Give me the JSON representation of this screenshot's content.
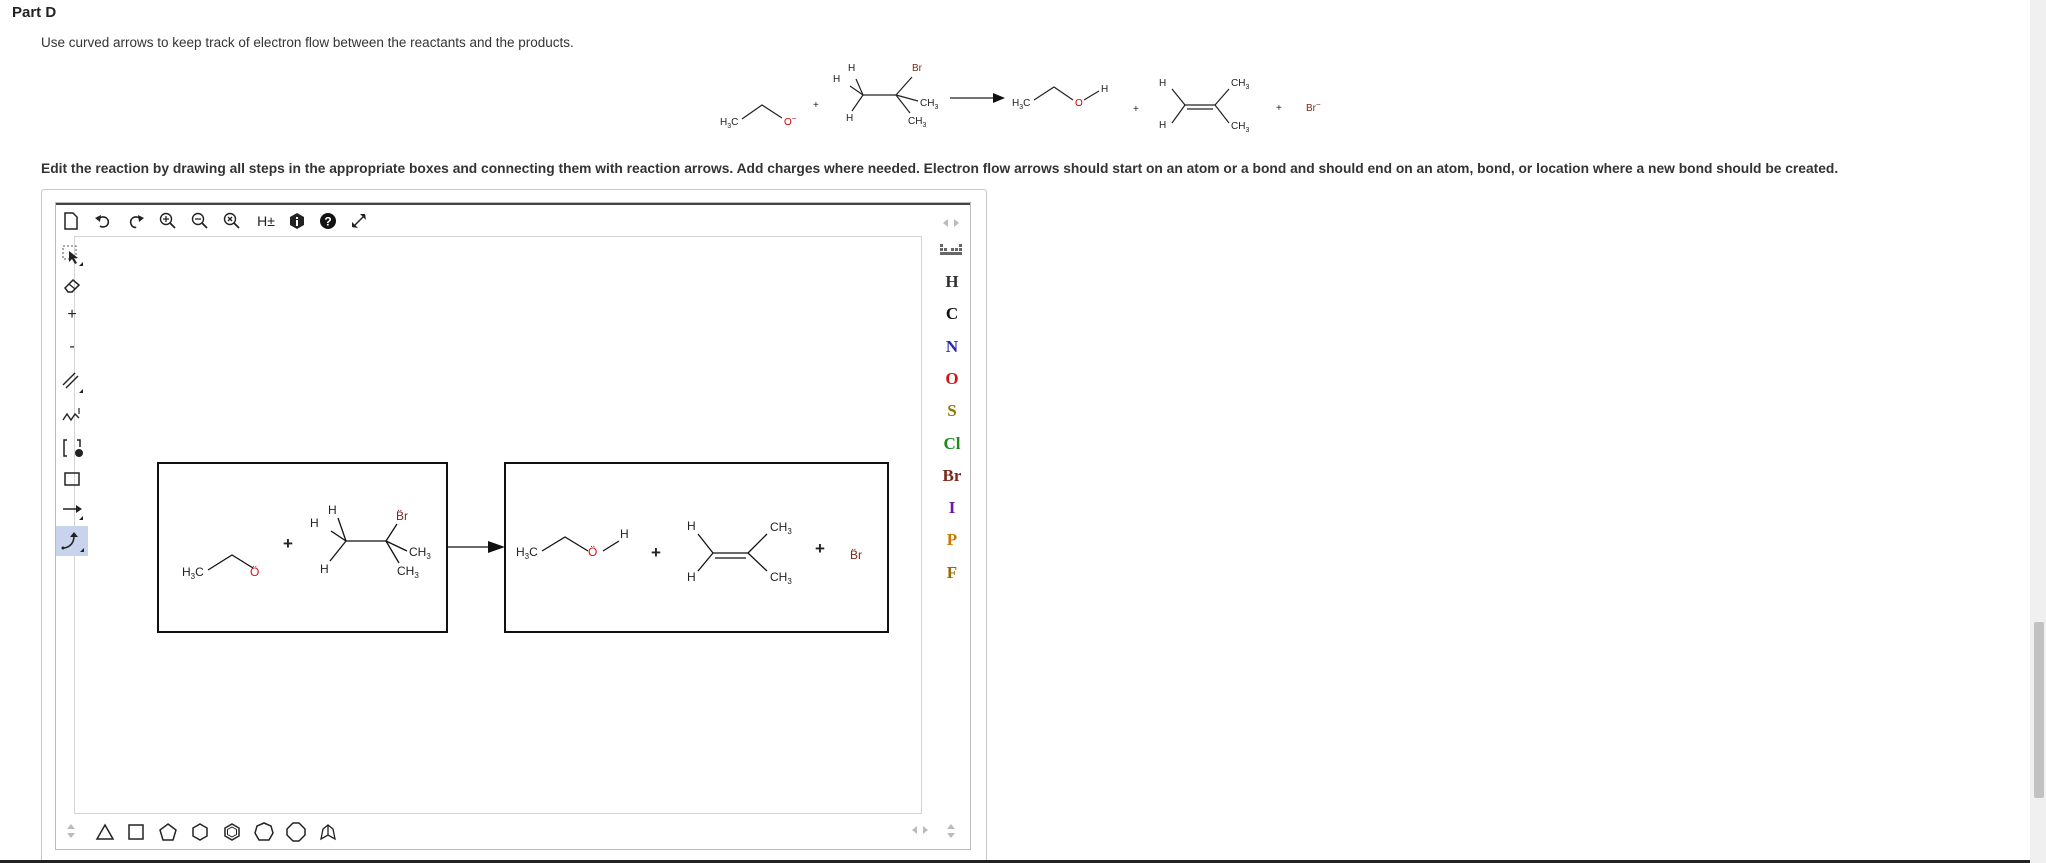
{
  "part_title": "Part D",
  "instruction": "Use curved arrows to keep track of electron flow between the reactants and the products.",
  "edit_instruction": "Edit the reaction by drawing all steps in the appropriate boxes and connecting them with reaction arrows. Add charges where needed. Electron flow arrows should start on an atom or a bond and should end on an atom, bond, or location where a new bond should be created.",
  "scheme": {
    "methyl": "H",
    "methyl_sub": "3",
    "methyl_c": "C",
    "oxide": "O",
    "oxide_charge": "−",
    "plus": "+",
    "h": "H",
    "br": "Br",
    "ch": "CH",
    "sub3": "3",
    "bromide": "Br",
    "bromide_charge": "−"
  },
  "top_toolbar": {
    "hplusminus": "H±"
  },
  "left_toolbar": {
    "plus_label": "+",
    "minus_label": "-"
  },
  "elements": [
    "H",
    "C",
    "N",
    "O",
    "S",
    "Cl",
    "Br",
    "I",
    "P",
    "F"
  ],
  "element_colors": {
    "H": "#333333",
    "C": "#111111",
    "N": "#2a2aa8",
    "O": "#d01515",
    "S": "#8a7a00",
    "Cl": "#1a8a1a",
    "Br": "#7a2a1a",
    "I": "#6a1aa8",
    "P": "#c87800",
    "F": "#9a6a00"
  },
  "drawing": {
    "o_lone": "Ö",
    "br_lone": "B̈r",
    "plus": "+"
  }
}
